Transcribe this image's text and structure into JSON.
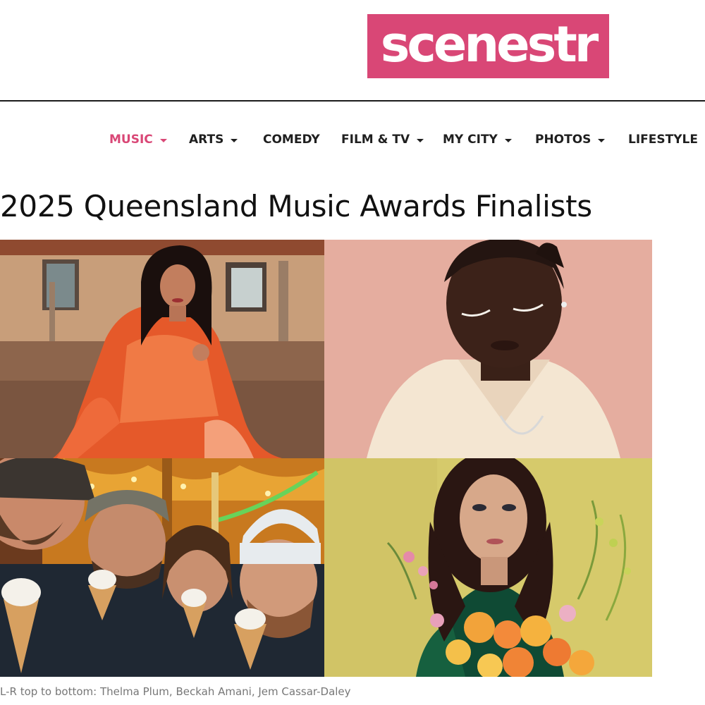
{
  "site": {
    "logo_text": "scenestr",
    "brand_color": "#d94776"
  },
  "nav": {
    "items": [
      {
        "label": "MUSIC",
        "dropdown": true,
        "active": true
      },
      {
        "label": "ARTS",
        "dropdown": true,
        "active": false
      },
      {
        "label": "COMEDY",
        "dropdown": false,
        "active": false
      },
      {
        "label": "FILM & TV",
        "dropdown": true,
        "active": false
      },
      {
        "label": "MY CITY",
        "dropdown": true,
        "active": false
      },
      {
        "label": "PHOTOS",
        "dropdown": true,
        "active": false
      },
      {
        "label": "LIFESTYLE",
        "dropdown": true,
        "active": false
      }
    ]
  },
  "article": {
    "title": "2025 Queensland Music Awards Finalists",
    "caption": "L-R top to bottom: Thelma Plum, Beckah Amani, Jem Cassar-Daley"
  }
}
